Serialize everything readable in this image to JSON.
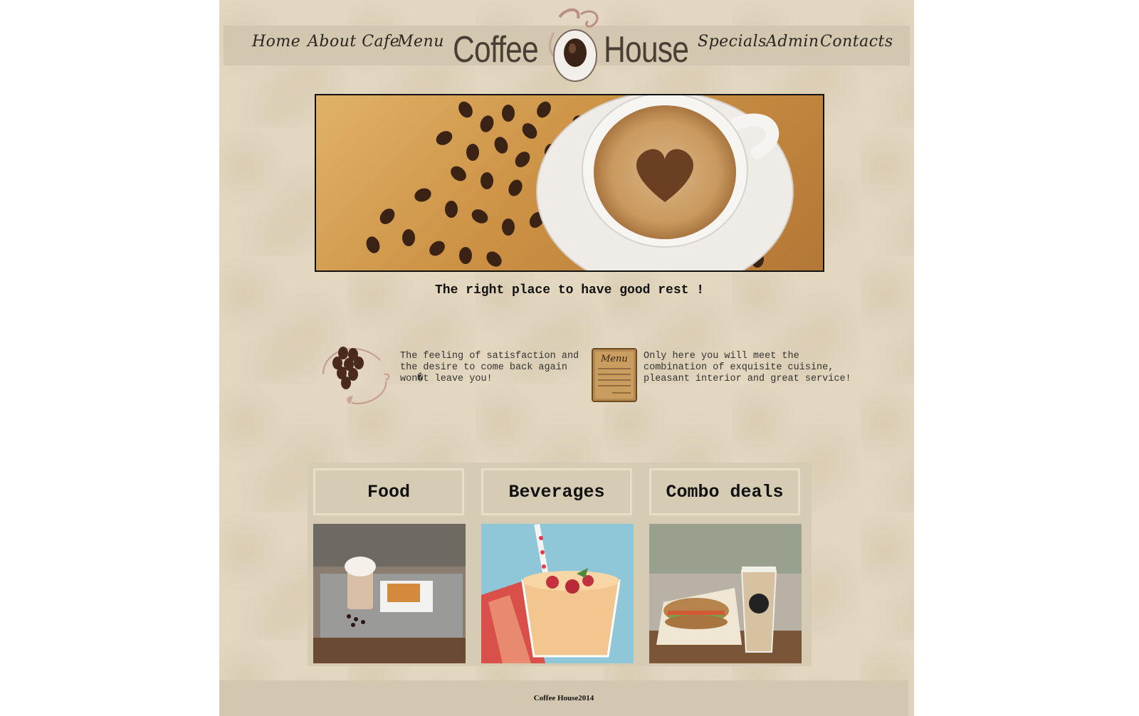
{
  "nav": {
    "left": [
      "Home",
      "About Cafe",
      "Menu"
    ],
    "right": [
      "Specials",
      "Admin",
      "Contacts"
    ]
  },
  "logo": {
    "word1": "Coffee",
    "word2": "House"
  },
  "hero": {
    "tagline": "The right place to have good rest !"
  },
  "features": [
    {
      "icon": "coffee-beans-icon",
      "text": "The feeling of satisfaction and\nthe desire to come back again\nwon�t leave you!"
    },
    {
      "icon": "menu-card-icon",
      "text": "Only here you will meet the\ncombination of exquisite cuisine,\npleasant interior and great service!"
    }
  ],
  "categories": [
    {
      "title": "Food",
      "image": "coffee-and-cake-photo"
    },
    {
      "title": "Beverages",
      "image": "smoothie-photo"
    },
    {
      "title": "Combo deals",
      "image": "sandwich-and-coffee-photo"
    }
  ],
  "footer": {
    "text": "Coffee House2014"
  },
  "colors": {
    "page_bg": "#e3d7bf",
    "nav_bg": "#d3c7af",
    "text_dark": "#111111",
    "logo_text": "#4a3f35"
  }
}
